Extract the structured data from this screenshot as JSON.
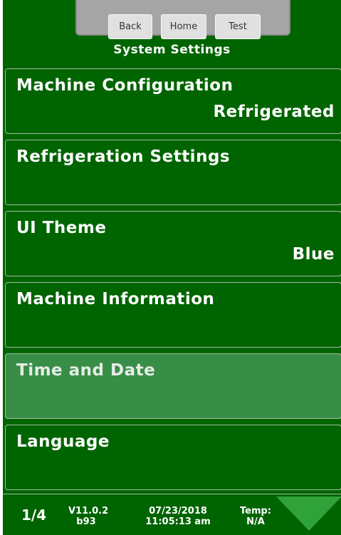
{
  "nav": {
    "back_label": "Back",
    "home_label": "Home",
    "test_label": "Test"
  },
  "screen_title": "System Settings",
  "menu_items": [
    {
      "label": "Machine Configuration",
      "value": "Refrigerated"
    },
    {
      "label": "Refrigeration Settings",
      "value": ""
    },
    {
      "label": "UI Theme",
      "value": "Blue"
    },
    {
      "label": "Machine Information",
      "value": ""
    },
    {
      "label": "Time and Date",
      "value": "",
      "selected": true
    },
    {
      "label": "Language",
      "value": ""
    }
  ],
  "status": {
    "page": "1/4",
    "version": "V11.0.2",
    "build": "b93",
    "date": "07/23/2018",
    "time": "11:05:13 am",
    "temp_label": "Temp:",
    "temp_value": "N/A"
  },
  "colors": {
    "background": "#006400",
    "selected_item": "#388e47",
    "arrow": "#2fa33a",
    "nav_panel": "#a5a5a5"
  },
  "icons": {
    "page_down": "triangle-down-icon"
  }
}
